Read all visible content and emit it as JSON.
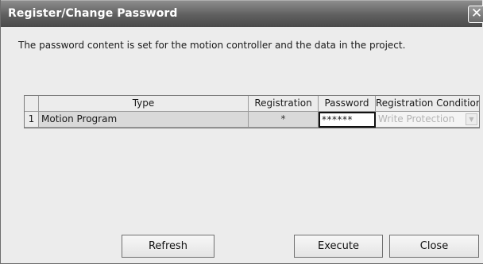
{
  "window": {
    "title": "Register/Change Password",
    "close_glyph": "✕"
  },
  "description": "The password content is set for the motion controller and the data in the project.",
  "table": {
    "columns": [
      "",
      "Type",
      "Registration",
      "Password",
      "Registration Condition"
    ],
    "rows": [
      {
        "index": "1",
        "type": "Motion Program",
        "registration": "*",
        "password": "******",
        "condition": "Write Protection"
      }
    ],
    "dropdown_icon": "chevron-down-icon"
  },
  "buttons": {
    "refresh": "Refresh",
    "execute": "Execute",
    "close": "Close"
  }
}
